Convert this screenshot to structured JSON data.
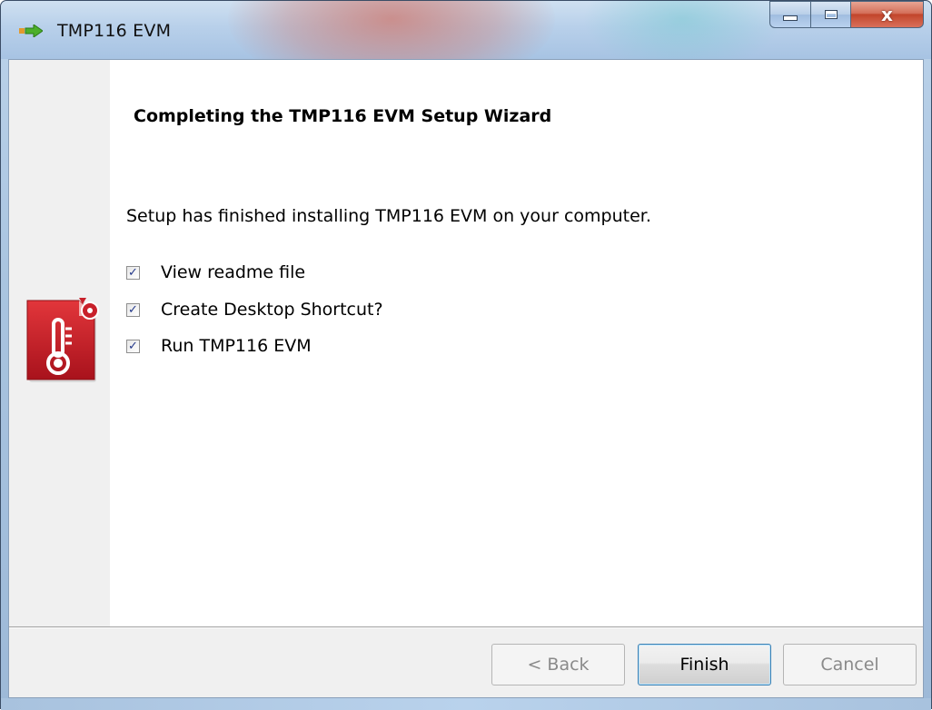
{
  "window": {
    "title": "TMP116 EVM",
    "icon": "installer-arrow-icon"
  },
  "caption_buttons": {
    "minimize_icon": "minimize-icon",
    "maximize_icon": "maximize-icon",
    "close_icon": "close-icon",
    "close_glyph": "x"
  },
  "wizard": {
    "heading": "Completing the TMP116 EVM Setup Wizard",
    "message": "Setup has finished installing TMP116 EVM on your computer.",
    "side_icon": "thermometer-install-icon",
    "options": [
      {
        "label": "View readme file",
        "checked": true
      },
      {
        "label": "Create Desktop Shortcut?",
        "checked": true
      },
      {
        "label": "Run TMP116 EVM",
        "checked": true
      }
    ]
  },
  "buttons": {
    "back": "< Back",
    "finish": "Finish",
    "cancel": "Cancel"
  },
  "colors": {
    "icon_red": "#c8202a",
    "check_blue": "#23388a",
    "default_button_border": "#3c7fb1"
  }
}
